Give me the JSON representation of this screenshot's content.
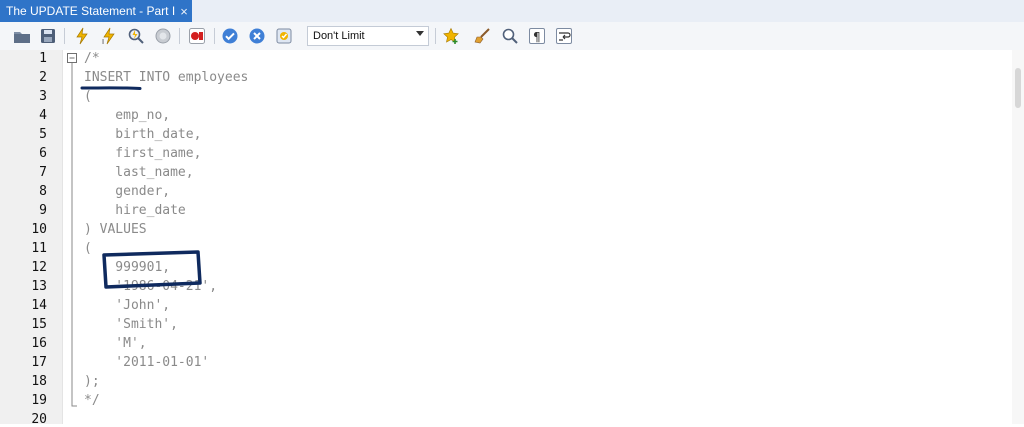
{
  "tab": {
    "title": "The UPDATE Statement - Part I",
    "close_glyph": "×"
  },
  "toolbar": {
    "limit_value": "Don't Limit",
    "icons": [
      "open-file-icon",
      "save-icon",
      "execute-icon",
      "execute-current-icon",
      "explain-icon",
      "stop-icon",
      "toggle-error-icon",
      "commit-icon",
      "rollback-icon",
      "autocommit-icon",
      "favorite-add-icon",
      "beautify-icon",
      "find-icon",
      "invisibles-icon",
      "wrap-icon"
    ]
  },
  "editor": {
    "line_numbers": [
      "1",
      "2",
      "3",
      "4",
      "5",
      "6",
      "7",
      "8",
      "9",
      "10",
      "11",
      "12",
      "13",
      "14",
      "15",
      "16",
      "17",
      "18",
      "19",
      "20"
    ],
    "lines": [
      "/*",
      "INSERT INTO employees",
      "(",
      "    emp_no,",
      "    birth_date,",
      "    first_name,",
      "    last_name,",
      "    gender,",
      "    hire_date",
      ") VALUES",
      "(",
      "    999901,",
      "    '1986-04-21',",
      "    'John',",
      "    'Smith',",
      "    'M',",
      "    '2011-01-01'",
      ");",
      "*/",
      ""
    ]
  },
  "colors": {
    "tab": "#2f74c8",
    "comment": "#8a8a8a",
    "annotation": "#0f2a5e"
  }
}
